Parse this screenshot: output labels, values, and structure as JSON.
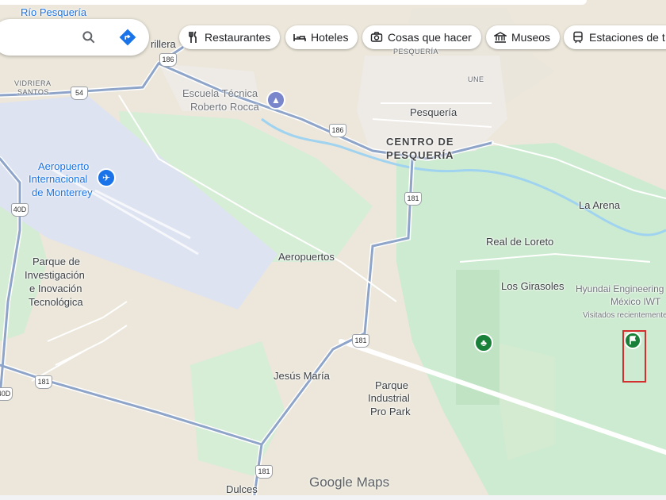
{
  "search": {
    "search_icon": "search-icon",
    "directions_icon": "directions-icon"
  },
  "chips": [
    {
      "label": "Restaurantes",
      "icon": "restaurant-icon"
    },
    {
      "label": "Hoteles",
      "icon": "hotel-icon"
    },
    {
      "label": "Cosas que hacer",
      "icon": "camera-icon"
    },
    {
      "label": "Museos",
      "icon": "museum-icon"
    },
    {
      "label": "Estaciones de t",
      "icon": "train-icon"
    }
  ],
  "places": {
    "rio_pesqueria": "Río Pesquería",
    "rillera": "rillera",
    "vidriera": "VIDRIERA",
    "santos": "SANTOS",
    "escuela_line1": "Escuela Técnica",
    "escuela_line2": "Roberto Rocca",
    "pesqueria_top": "PESQUERÍA",
    "une": "UNE",
    "pesqueria": "Pesquería",
    "centro_line1": "CENTRO DE",
    "centro_line2": "PESQUERÍA",
    "aeropuerto_line1": "Aeropuerto",
    "aeropuerto_line2": "Internacional",
    "aeropuerto_line3": "de Monterrey",
    "la_arena": "La Arena",
    "real_de_loreto": "Real de Loreto",
    "aeropuertos": "Aeropuertos",
    "parque_inv_line1": "Parque de",
    "parque_inv_line2": "Investigación",
    "parque_inv_line3": "e Inovación",
    "parque_inv_line4": "Tecnológica",
    "los_girasoles": "Los Girasoles",
    "hyundai_line1": "Hyundai Engineering",
    "hyundai_line2": "México IWT",
    "visitados": "Visitados recientemente",
    "jesus_maria": "Jesús María",
    "parque_ind_line1": "Parque",
    "parque_ind_line2": "Industrial",
    "parque_ind_line3": "Pro Park",
    "dulces": "Dulces"
  },
  "shields": {
    "r186_a": "186",
    "r54": "54",
    "r186_b": "186",
    "r181_a": "181",
    "r40d": "40D",
    "r181_b": "181",
    "r181_c": "181",
    "r40d_b": "40D",
    "r181_d": "181"
  },
  "logo": {
    "google": "Google",
    "maps": "Maps"
  },
  "colors": {
    "land": "#e9e4d6",
    "green": "#cdeccf",
    "airport": "#dde4f2",
    "road": "#8ea4c8",
    "water": "#9fd3f0",
    "flag": "#188038",
    "highlight": "#d32f2f"
  }
}
